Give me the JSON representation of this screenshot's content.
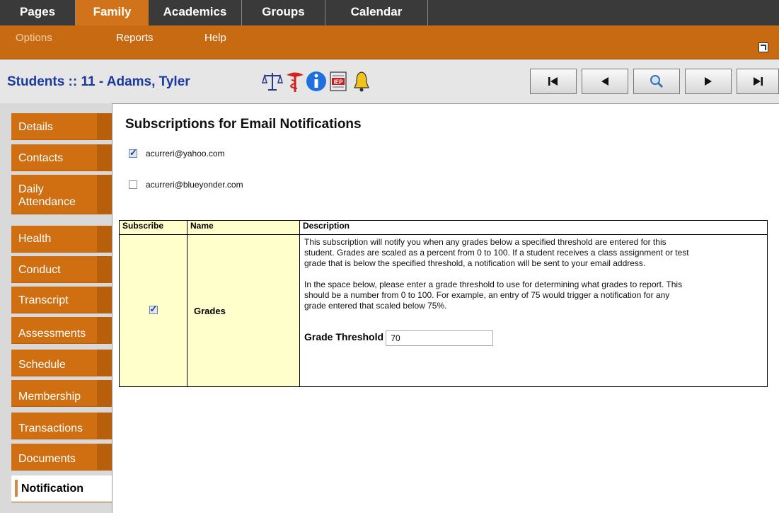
{
  "topnav": {
    "tabs": [
      {
        "label": "Pages"
      },
      {
        "label": "Family"
      },
      {
        "label": "Academics"
      },
      {
        "label": "Groups"
      },
      {
        "label": "Calendar"
      }
    ],
    "active": "Family"
  },
  "subnav": {
    "items": [
      {
        "label": "Options"
      },
      {
        "label": "Reports"
      },
      {
        "label": "Help"
      }
    ]
  },
  "header": {
    "title": "Students :: 11 - Adams, Tyler",
    "icons": [
      "scales-icon",
      "medical-caduceus-icon",
      "info-icon",
      "iep-document-icon",
      "bell-icon"
    ],
    "nav_buttons": [
      "first-record-icon",
      "previous-record-icon",
      "search-icon",
      "next-record-icon",
      "last-record-icon"
    ]
  },
  "sidebar": {
    "items": [
      {
        "label": "Details"
      },
      {
        "label": "Contacts"
      },
      {
        "label": "Daily\nAttendance"
      },
      {
        "label": "Health"
      },
      {
        "label": "Conduct"
      },
      {
        "label": "Transcript"
      },
      {
        "label": "Assessments"
      },
      {
        "label": "Schedule"
      },
      {
        "label": "Membership"
      },
      {
        "label": "Transactions"
      },
      {
        "label": "Documents"
      },
      {
        "label": "Notification"
      }
    ],
    "active": "Notification"
  },
  "main": {
    "heading": "Subscriptions for Email Notifications",
    "emails": [
      {
        "address": "acurreri@yahoo.com",
        "checked": true
      },
      {
        "address": "acurreri@blueyonder.com",
        "checked": false
      }
    ],
    "table": {
      "headers": {
        "subscribe": "Subscribe",
        "name": "Name",
        "description": "Description"
      },
      "row": {
        "checked": true,
        "name": "Grades",
        "description_p1": "This subscription will notify you when any grades below a specified threshold are entered for this student. Grades are scaled as a percent from 0 to 100. If a student receives a class assignment or test grade that is below the specified threshold, a notification will be sent to your email address.",
        "description_p2": "In the space below, please enter a grade threshold to use for determining what grades to report. This should be a number from 0 to 100. For example, an entry of 75 would trigger a notification for any grade entered that scaled below 75%.",
        "threshold_label": "Grade Threshold",
        "threshold_value": "70"
      }
    }
  },
  "colors": {
    "topnav_bg": "#3a3a3a",
    "accent_orange": "#cf6f12",
    "title_blue": "#1a3aa0",
    "highlight_yellow": "#ffffcc"
  }
}
